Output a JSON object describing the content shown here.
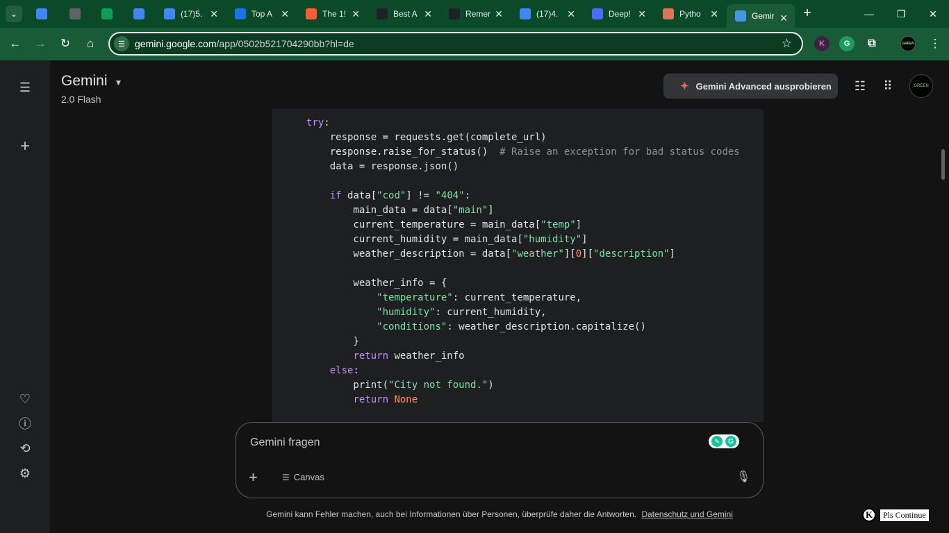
{
  "browser": {
    "tabs": [
      {
        "title": "",
        "favicon": "google-docs-icon",
        "color": "#4285f4"
      },
      {
        "title": "",
        "favicon": "globe-icon",
        "color": "#5f6368"
      },
      {
        "title": "",
        "favicon": "google-sheets-icon",
        "color": "#0f9d58"
      },
      {
        "title": "",
        "favicon": "google-docs-icon",
        "color": "#4285f4"
      },
      {
        "title": "(17)5.",
        "favicon": "google-docs-icon",
        "color": "#4285f4"
      },
      {
        "title": "Top A",
        "favicon": "loader-icon",
        "color": "#1a73e8"
      },
      {
        "title": "The 1!",
        "favicon": "hubspot-icon",
        "color": "#ff5c35"
      },
      {
        "title": "Best A",
        "favicon": "text-icon",
        "color": "#202124"
      },
      {
        "title": "Remer",
        "favicon": "openai-icon",
        "color": "#202124"
      },
      {
        "title": "(17)4.",
        "favicon": "google-docs-icon",
        "color": "#4285f4"
      },
      {
        "title": "Deep!",
        "favicon": "deepseek-icon",
        "color": "#4d6bfe"
      },
      {
        "title": "Pytho",
        "favicon": "claude-icon",
        "color": "#d97757"
      },
      {
        "title": "Gemir",
        "favicon": "gemini-icon",
        "color": "#4796e3"
      }
    ],
    "url_host": "gemini.google.com",
    "url_path": "/app/0502b521704290bb?hl=de",
    "extension_k": "K",
    "extension_g": "G",
    "profile_label": "GREEN"
  },
  "sidebar": {
    "items": [
      "menu-icon",
      "new-chat-icon",
      "gems-icon",
      "help-icon",
      "activity-icon",
      "settings-icon"
    ]
  },
  "header": {
    "title": "Gemini",
    "model": "2.0 Flash",
    "advanced_label": "Gemini Advanced ausprobieren",
    "avatar_text": "GREEN"
  },
  "code_lines": [
    [
      {
        "t": "try",
        "c": "kw"
      },
      {
        "t": ":",
        "c": ""
      }
    ],
    [
      {
        "t": "    response = requests.get(complete_url)",
        "c": ""
      }
    ],
    [
      {
        "t": "    response.raise_for_status()  ",
        "c": ""
      },
      {
        "t": "# Raise an exception for bad status codes",
        "c": "cm"
      }
    ],
    [
      {
        "t": "    data = response.json()",
        "c": ""
      }
    ],
    [
      {
        "t": "",
        "c": ""
      }
    ],
    [
      {
        "t": "    ",
        "c": ""
      },
      {
        "t": "if",
        "c": "kw"
      },
      {
        "t": " data[",
        "c": ""
      },
      {
        "t": "\"cod\"",
        "c": "st"
      },
      {
        "t": "] != ",
        "c": ""
      },
      {
        "t": "\"404\"",
        "c": "st"
      },
      {
        "t": ":",
        "c": ""
      }
    ],
    [
      {
        "t": "        main_data = data[",
        "c": ""
      },
      {
        "t": "\"main\"",
        "c": "st"
      },
      {
        "t": "]",
        "c": ""
      }
    ],
    [
      {
        "t": "        current_temperature = main_data[",
        "c": ""
      },
      {
        "t": "\"temp\"",
        "c": "st"
      },
      {
        "t": "]",
        "c": ""
      }
    ],
    [
      {
        "t": "        current_humidity = main_data[",
        "c": ""
      },
      {
        "t": "\"humidity\"",
        "c": "st"
      },
      {
        "t": "]",
        "c": ""
      }
    ],
    [
      {
        "t": "        weather_description = data[",
        "c": ""
      },
      {
        "t": "\"weather\"",
        "c": "st"
      },
      {
        "t": "][",
        "c": ""
      },
      {
        "t": "0",
        "c": "nm"
      },
      {
        "t": "][",
        "c": ""
      },
      {
        "t": "\"description\"",
        "c": "st"
      },
      {
        "t": "]",
        "c": ""
      }
    ],
    [
      {
        "t": "",
        "c": ""
      }
    ],
    [
      {
        "t": "        weather_info = {",
        "c": ""
      }
    ],
    [
      {
        "t": "            ",
        "c": ""
      },
      {
        "t": "\"temperature\"",
        "c": "st"
      },
      {
        "t": ": current_temperature,",
        "c": ""
      }
    ],
    [
      {
        "t": "            ",
        "c": ""
      },
      {
        "t": "\"humidity\"",
        "c": "st"
      },
      {
        "t": ": current_humidity,",
        "c": ""
      }
    ],
    [
      {
        "t": "            ",
        "c": ""
      },
      {
        "t": "\"conditions\"",
        "c": "st"
      },
      {
        "t": ": weather_description.capitalize()",
        "c": ""
      }
    ],
    [
      {
        "t": "        }",
        "c": ""
      }
    ],
    [
      {
        "t": "        ",
        "c": ""
      },
      {
        "t": "return",
        "c": "kw"
      },
      {
        "t": " weather_info",
        "c": ""
      }
    ],
    [
      {
        "t": "    ",
        "c": ""
      },
      {
        "t": "else",
        "c": "kw"
      },
      {
        "t": ":",
        "c": ""
      }
    ],
    [
      {
        "t": "        print(",
        "c": ""
      },
      {
        "t": "\"City not found.\"",
        "c": "st"
      },
      {
        "t": ")",
        "c": ""
      }
    ],
    [
      {
        "t": "        ",
        "c": ""
      },
      {
        "t": "return",
        "c": "kw"
      },
      {
        "t": " ",
        "c": ""
      },
      {
        "t": "None",
        "c": "nm"
      }
    ]
  ],
  "input": {
    "placeholder": "Gemini fragen",
    "canvas_label": "Canvas"
  },
  "footer": {
    "text": "Gemini kann Fehler machen, auch bei Informationen über Personen, überprüfe daher die Antworten.",
    "link": "Datenschutz und Gemini"
  },
  "overlay": {
    "k_label": "K",
    "continue_label": "Pls Continue"
  }
}
